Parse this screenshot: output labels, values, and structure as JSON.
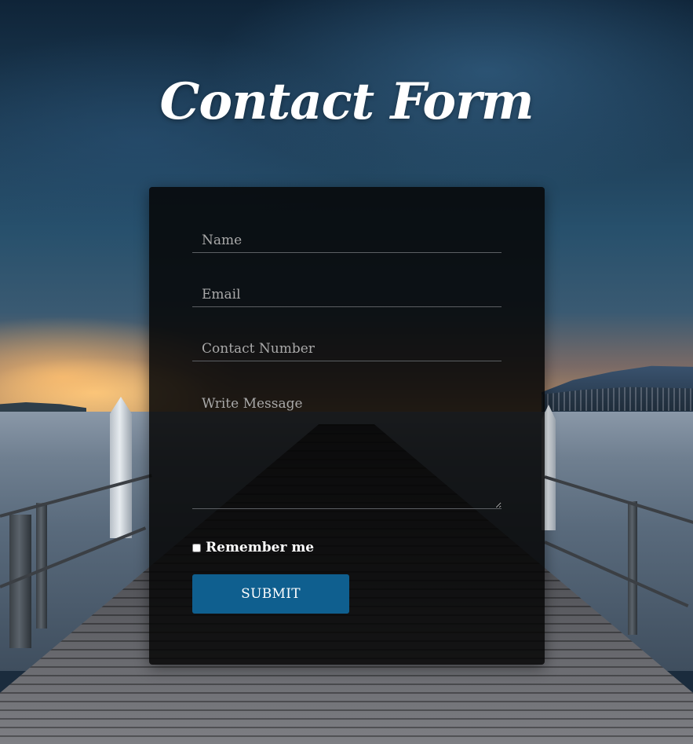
{
  "header": {
    "title": "Contact Form"
  },
  "form": {
    "name_placeholder": "Name",
    "email_placeholder": "Email",
    "phone_placeholder": "Contact Number",
    "message_placeholder": "Write Message",
    "remember_label": "Remember me",
    "submit_label": "SUBMIT"
  },
  "colors": {
    "card_background": "#060606",
    "submit_button": "#0f5f8f",
    "field_underline": "#5c5f63",
    "placeholder_text": "#a9a9a9"
  }
}
